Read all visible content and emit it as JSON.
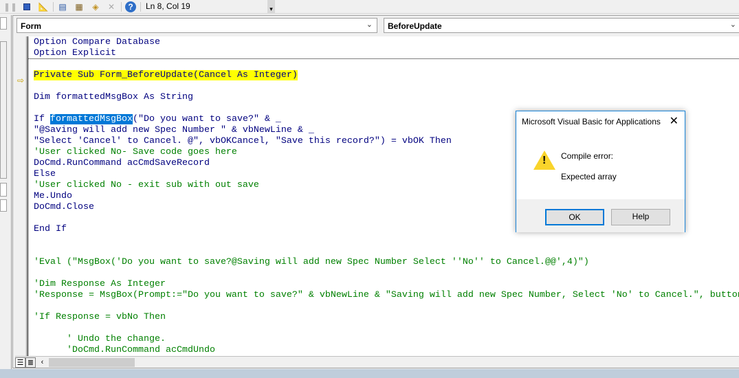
{
  "toolbar": {
    "icons": [
      "pause-icon",
      "stop-icon",
      "design-mode-icon",
      "project-explorer-icon",
      "properties-icon",
      "object-browser-icon",
      "toolbox-icon",
      "help-icon"
    ],
    "status": "Ln 8, Col 19"
  },
  "code_window": {
    "object_combo": "Form",
    "procedure_combo": "BeforeUpdate",
    "lines": [
      {
        "text": "Option Compare Database",
        "type": "code"
      },
      {
        "text": "Option Explicit",
        "type": "code"
      },
      {
        "text": "",
        "type": "code"
      },
      {
        "text": "Private Sub Form_BeforeUpdate(Cancel As Integer)",
        "type": "exec"
      },
      {
        "text": "",
        "type": "code"
      },
      {
        "text": "Dim formattedMsgBox As String",
        "type": "code"
      },
      {
        "text": "",
        "type": "code"
      },
      {
        "text": "If ",
        "type": "code",
        "selected": "formattedMsgBox",
        "rest": "(\"Do you want to save?\" & _"
      },
      {
        "text": "\"@Saving will add new Spec Number \" & vbNewLine & _",
        "type": "code"
      },
      {
        "text": "\"Select 'Cancel' to Cancel. @\", vbOKCancel, \"Save this record?\") = vbOK Then",
        "type": "code"
      },
      {
        "text": "'User clicked No- Save code goes here",
        "type": "comment"
      },
      {
        "text": "DoCmd.RunCommand acCmdSaveRecord",
        "type": "code"
      },
      {
        "text": "Else",
        "type": "code"
      },
      {
        "text": "'User clicked No - exit sub with out save",
        "type": "comment"
      },
      {
        "text": "Me.Undo",
        "type": "code"
      },
      {
        "text": "DoCmd.Close",
        "type": "code"
      },
      {
        "text": "",
        "type": "code"
      },
      {
        "text": "End If",
        "type": "code"
      },
      {
        "text": "",
        "type": "code"
      },
      {
        "text": "",
        "type": "code"
      },
      {
        "text": "'Eval (\"MsgBox('Do you want to save?@Saving will add new Spec Number Select ''No'' to Cancel.@@',4)\")",
        "type": "comment"
      },
      {
        "text": "",
        "type": "code"
      },
      {
        "text": "'Dim Response As Integer",
        "type": "comment"
      },
      {
        "text": "'Response = MsgBox(Prompt:=\"Do you want to save?\" & vbNewLine & \"Saving will add new Spec Number, Select 'No' to Cancel.\", buttons",
        "type": "comment"
      },
      {
        "text": "",
        "type": "code"
      },
      {
        "text": "'If Response = vbNo Then",
        "type": "comment"
      },
      {
        "text": "",
        "type": "code"
      },
      {
        "text": "      ' Undo the change.",
        "type": "comment"
      },
      {
        "text": "      'DoCmd.RunCommand acCmdUndo",
        "type": "comment"
      }
    ]
  },
  "dialog": {
    "title": "Microsoft Visual Basic for Applications",
    "message_title": "Compile error:",
    "message": "Expected array",
    "ok_label": "OK",
    "help_label": "Help"
  }
}
